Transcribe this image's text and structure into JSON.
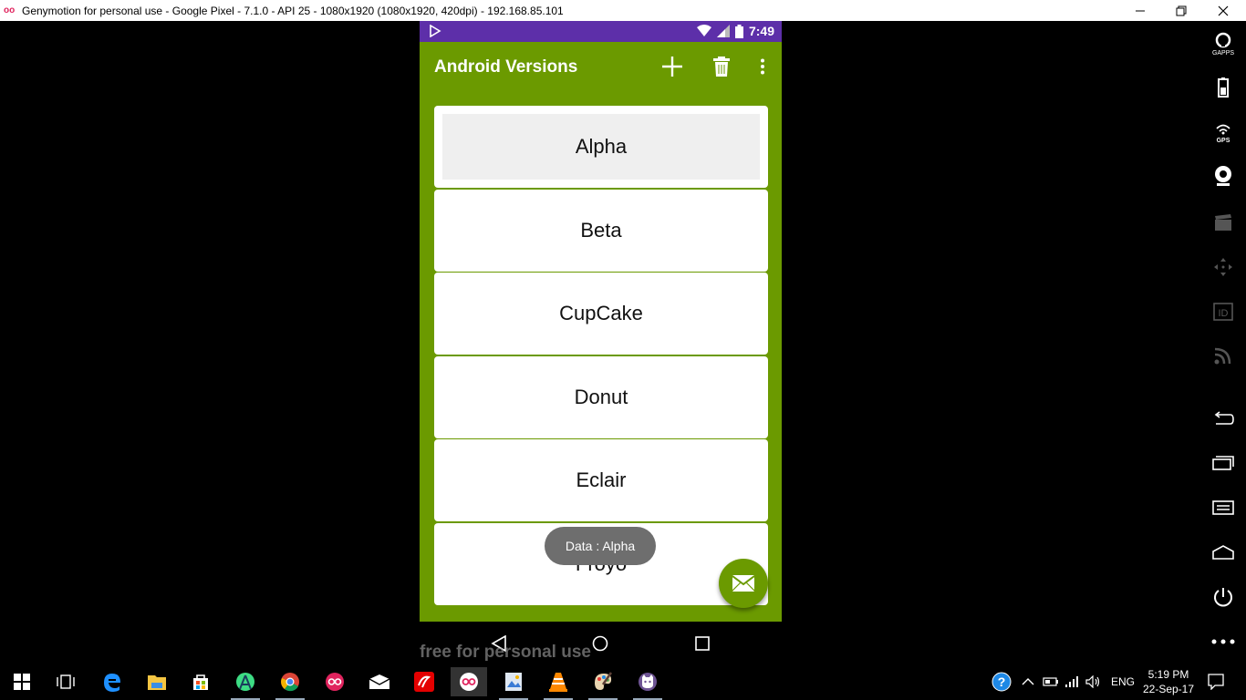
{
  "window": {
    "title": "Genymotion for personal use - Google Pixel - 7.1.0 - API 25 - 1080x1920 (1080x1920, 420dpi) - 192.168.85.101",
    "app_icon": "oo",
    "controls": [
      "minimize-icon",
      "restore-icon",
      "close-icon"
    ]
  },
  "statusbar": {
    "time": "7:49",
    "icons": [
      "play-store-icon",
      "wifi-icon",
      "signal-icon",
      "battery-icon"
    ]
  },
  "appbar": {
    "title": "Android Versions",
    "actions": [
      "add-icon",
      "delete-icon",
      "more-vert-icon"
    ],
    "color": "#6b9a00"
  },
  "list": {
    "items": [
      "Alpha",
      "Beta",
      "CupCake",
      "Donut",
      "Eclair",
      "Froyo"
    ],
    "selected": "Alpha"
  },
  "toast": {
    "text": "Data : Alpha"
  },
  "fab": {
    "icon": "email-icon"
  },
  "navbar": {
    "buttons": [
      "back-icon",
      "home-icon",
      "recents-icon"
    ]
  },
  "watermark": "free for personal use",
  "genymotion_toolbar": [
    "gapps-icon",
    "battery-icon",
    "gps-icon",
    "camera-icon",
    "media-icon",
    "dpad-icon",
    "id-icon",
    "rss-icon",
    "back-icon",
    "recent-apps-icon",
    "menu-icon",
    "home-icon",
    "power-icon",
    "more-icon"
  ],
  "taskbar": {
    "apps": [
      "windows-start-icon",
      "task-view-icon",
      "edge-icon",
      "file-explorer-icon",
      "store-icon",
      "android-studio-icon",
      "chrome-icon",
      "genymotion-icon",
      "mail-icon",
      "airtel-icon",
      "genymotion-active-icon",
      "photos-icon",
      "vlc-icon",
      "paint-icon",
      "github-icon"
    ],
    "language": "ENG",
    "clock_time": "5:19 PM",
    "clock_date": "22-Sep-17"
  }
}
